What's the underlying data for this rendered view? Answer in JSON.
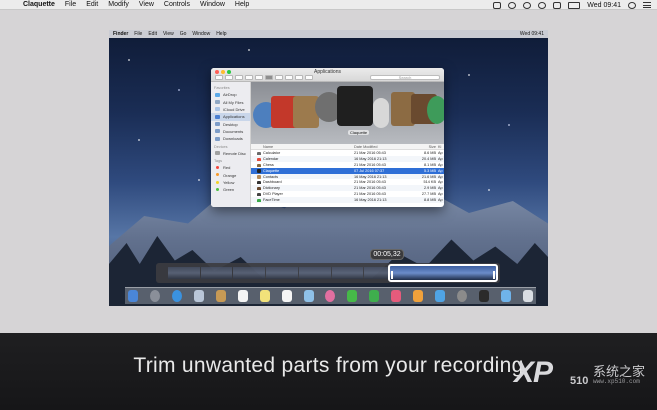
{
  "menubar": {
    "app_name": "Claquette",
    "items": [
      "File",
      "Edit",
      "Modify",
      "View",
      "Controls",
      "Window",
      "Help"
    ],
    "clock": "Wed 09:41"
  },
  "inner_menubar": {
    "app_name": "Finder",
    "items": [
      "File",
      "Edit",
      "View",
      "Go",
      "Window",
      "Help"
    ],
    "clock": "Wed 09:41"
  },
  "finder": {
    "title": "Applications",
    "search_placeholder": "Search",
    "preview_label": "Claquette",
    "sidebar": [
      {
        "heading": "Favorites",
        "items": [
          "AirDrop",
          "All My Files",
          "iCloud Drive",
          "Applications",
          "Desktop",
          "Documents",
          "Downloads"
        ]
      },
      {
        "heading": "Devices",
        "items": [
          "Remote Disc"
        ]
      },
      {
        "heading": "Tags",
        "items": [
          "Red",
          "Orange",
          "Yellow",
          "Green"
        ]
      }
    ],
    "selected_sidebar": "Applications",
    "columns": [
      "Name",
      "Date Modified",
      "Size",
      "Ki"
    ],
    "rows": [
      {
        "name": "Calculator",
        "date": "21 Mar 2016 05:43",
        "size": "8.6 MB",
        "kind": "Ap",
        "color": "#6b6b6b"
      },
      {
        "name": "Calendar",
        "date": "16 May 2016 21:13",
        "size": "20.4 MB",
        "kind": "Ap",
        "color": "#e64b3c"
      },
      {
        "name": "Chess",
        "date": "21 Mar 2016 05:43",
        "size": "8.1 MB",
        "kind": "Ap",
        "color": "#8b6a3e"
      },
      {
        "name": "Claquette",
        "date": "07 Jul 2016 07:37",
        "size": "5.3 MB",
        "kind": "Ap",
        "color": "#222222"
      },
      {
        "name": "Contacts",
        "date": "16 May 2016 21:13",
        "size": "21.6 MB",
        "kind": "Ap",
        "color": "#b58a57"
      },
      {
        "name": "Dashboard",
        "date": "21 Mar 2016 05:43",
        "size": "514 KB",
        "kind": "Ap",
        "color": "#333333"
      },
      {
        "name": "Dictionary",
        "date": "21 Mar 2016 05:43",
        "size": "2.9 MB",
        "kind": "Ap",
        "color": "#6a4a2f"
      },
      {
        "name": "DVD Player",
        "date": "21 Mar 2016 05:43",
        "size": "27.7 MB",
        "kind": "Ap",
        "color": "#444444"
      },
      {
        "name": "FaceTime",
        "date": "16 May 2016 21:13",
        "size": "8.8 MB",
        "kind": "Ap",
        "color": "#3cab4a"
      }
    ],
    "selected_row": "Claquette"
  },
  "timeline": {
    "time": "00:05,32"
  },
  "caption": "Trim unwanted parts from your recording",
  "watermark": {
    "brand": "XP",
    "number": "510",
    "chinese": "系统之家",
    "url": "www.xp510.com"
  }
}
